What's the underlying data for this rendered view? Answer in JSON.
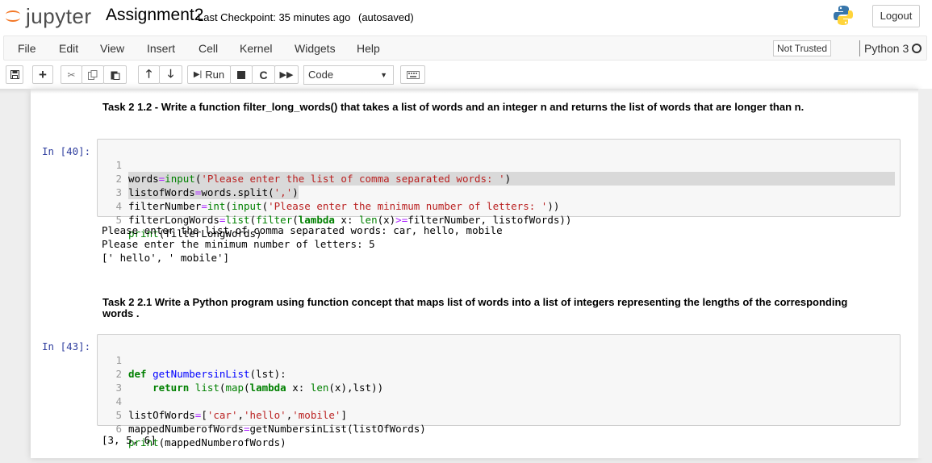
{
  "header": {
    "logo_text": "jupyter",
    "notebook_name": "Assignment2",
    "checkpoint": "Last Checkpoint: 35 minutes ago",
    "autosave": "(autosaved)",
    "logout_label": "Logout"
  },
  "menu": {
    "items": [
      "File",
      "Edit",
      "View",
      "Insert",
      "Cell",
      "Kernel",
      "Widgets",
      "Help"
    ],
    "trusted": "Not Trusted",
    "kernel": "Python 3"
  },
  "toolbar": {
    "run_label": "Run",
    "cell_type": "Code"
  },
  "cells": [
    {
      "markdown": "Task 2 1.2 - Write a function filter_long_words() that takes a list of words and an integer n and returns the list of words that are longer than n.",
      "prompt": "In [40]:",
      "code_lines": [
        "words=input('Please enter the list of comma separated words: ')",
        "listofWords=words.split(',')",
        "filterNumber=int(input('Please enter the minimum number of letters: '))",
        "filterLongWords=list(filter(lambda x: len(x)>=filterNumber, listofWords))",
        "print(filterLongWords)"
      ],
      "output_lines": [
        "Please enter the list of comma separated words: car, hello, mobile",
        "Please enter the minimum number of letters: 5",
        "[' hello', ' mobile']"
      ]
    },
    {
      "markdown": "Task 2 2.1 Write a Python program using function concept that maps list of words into a list of integers representing the lengths of the corresponding words .",
      "prompt": "In [43]:",
      "code_lines": [
        "def getNumbersinList(lst):",
        "    return list(map(lambda x: len(x),lst))",
        "",
        "listOfWords=['car','hello','mobile']",
        "mappedNumberofWords=getNumbersinList(listOfWords)",
        "print(mappedNumberofWords)"
      ],
      "output_lines": [
        "[3, 5, 6]"
      ]
    }
  ],
  "colors": {
    "prompt": "#303f9f",
    "keyword": "#008000",
    "string": "#ba2121",
    "operator": "#aa22ff",
    "logo_orange": "#f37726"
  },
  "icons": [
    "jupyter-logo-icon",
    "python-logo-icon",
    "save-icon",
    "plus-icon",
    "cut-icon",
    "copy-icon",
    "paste-icon",
    "arrow-up-icon",
    "arrow-down-icon",
    "run-icon",
    "stop-icon",
    "restart-icon",
    "fast-forward-icon",
    "keyboard-icon"
  ]
}
